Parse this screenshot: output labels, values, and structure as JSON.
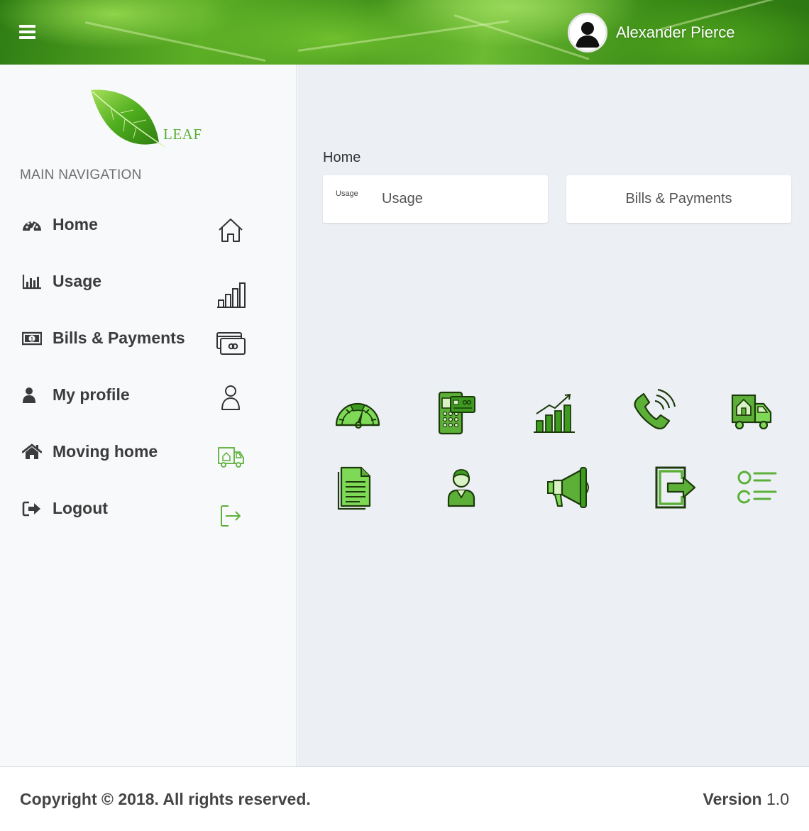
{
  "header": {
    "menu_icon": "hamburger-icon",
    "user_name": "Alexander Pierce",
    "avatar_icon": "user-silhouette-icon",
    "brand_green": "#4caf28"
  },
  "sidebar": {
    "logo_text": "LEAF",
    "nav_header": "MAIN NAVIGATION",
    "items": [
      {
        "label": "Home",
        "icon": "dashboard-icon",
        "right_icon": "house-outline-icon"
      },
      {
        "label": "Usage",
        "icon": "bar-chart-icon",
        "right_icon": "bars-outline-icon"
      },
      {
        "label": "Bills & Payments",
        "icon": "money-icon",
        "right_icon": "cards-outline-icon"
      },
      {
        "label": "My profile",
        "icon": "user-icon",
        "right_icon": "person-outline-icon"
      },
      {
        "label": "Moving home",
        "icon": "home-icon",
        "right_icon": "moving-truck-outline-icon"
      },
      {
        "label": "Logout",
        "icon": "sign-out-icon",
        "right_icon": "exit-outline-icon"
      }
    ]
  },
  "content": {
    "page_title": "Home",
    "cards": [
      {
        "small_label": "Usage",
        "label": "Usage"
      },
      {
        "label": "Bills & Payments"
      }
    ],
    "tiles": [
      "gauge-meter-icon",
      "prepaid-meter-icon",
      "growth-chart-icon",
      "phone-call-icon",
      "moving-truck-icon",
      "document-icon",
      "agent-person-icon",
      "megaphone-icon",
      "exit-door-icon",
      "checklist-icon"
    ]
  },
  "footer": {
    "copyright": "Copyright © 2018. All rights reserved.",
    "version_label": "Version",
    "version_number": "1.0"
  }
}
